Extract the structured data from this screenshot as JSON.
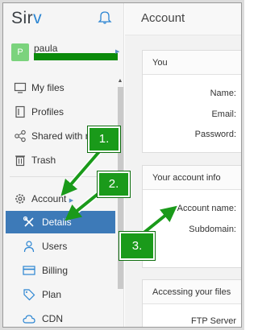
{
  "app": {
    "logo_text": "Sir",
    "logo_accent": "v"
  },
  "user": {
    "avatar_letter": "P",
    "name": "paula"
  },
  "nav": {
    "items": [
      {
        "id": "my-files",
        "label": "My files",
        "icon": "monitor-icon"
      },
      {
        "id": "profiles",
        "label": "Profiles",
        "icon": "document-icon"
      },
      {
        "id": "shared",
        "label": "Shared with n",
        "icon": "share-icon"
      },
      {
        "id": "trash",
        "label": "Trash",
        "icon": "trash-icon"
      }
    ],
    "account_label": "Account",
    "sub_items": [
      {
        "id": "details",
        "label": "Details",
        "icon": "tools-icon",
        "active": true
      },
      {
        "id": "users",
        "label": "Users",
        "icon": "user-icon"
      },
      {
        "id": "billing",
        "label": "Billing",
        "icon": "card-icon"
      },
      {
        "id": "plan",
        "label": "Plan",
        "icon": "tag-icon"
      },
      {
        "id": "cdn",
        "label": "CDN",
        "icon": "cloud-icon"
      }
    ]
  },
  "main": {
    "title": "Account",
    "you_card": {
      "heading": "You",
      "fields": [
        "Name:",
        "Email:",
        "Password:"
      ]
    },
    "account_info_card": {
      "heading": "Your account info",
      "fields": [
        "Account name:",
        "Subdomain:"
      ]
    },
    "files_card": {
      "heading": "Accessing your files",
      "fields": [
        "FTP Server"
      ]
    }
  },
  "annotations": [
    "1.",
    "2.",
    "3."
  ],
  "colors": {
    "active_bg": "#3d7ab8",
    "annotation_green": "#1a9a1a",
    "avatar": "#7bd37d",
    "brand_accent": "#2b85d2"
  }
}
